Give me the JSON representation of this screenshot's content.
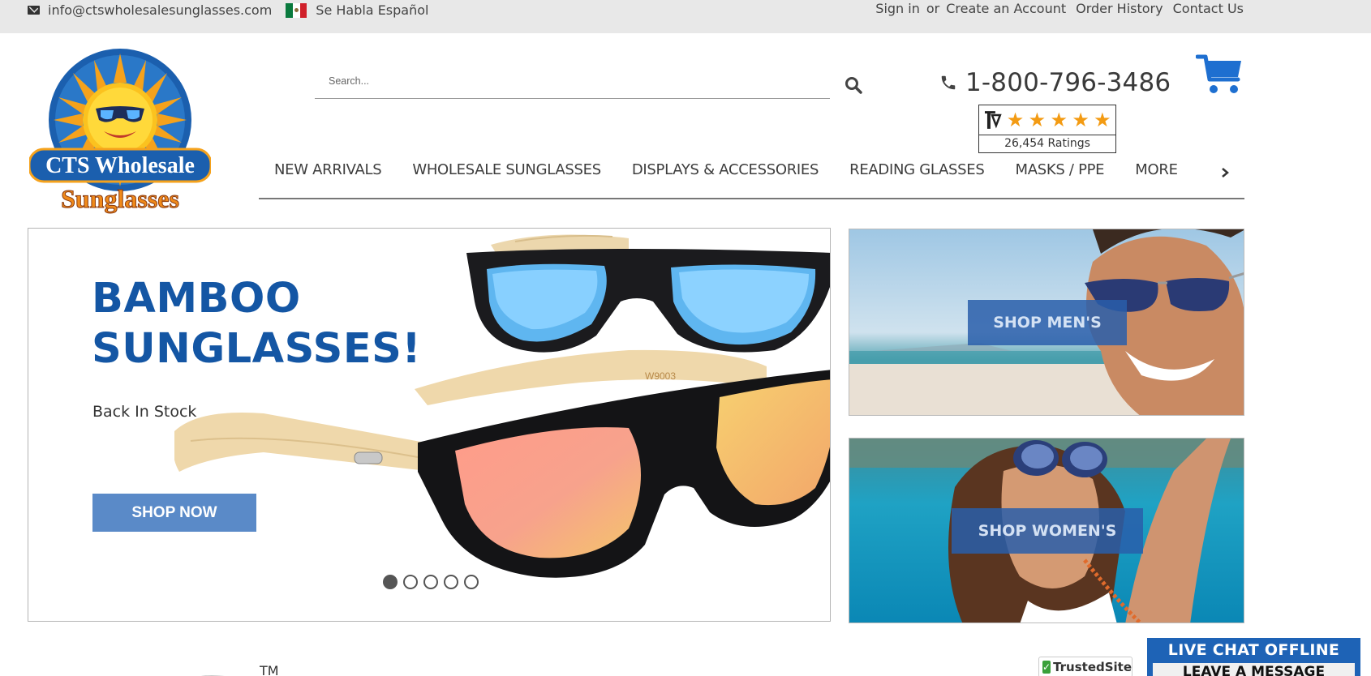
{
  "topbar": {
    "email": "info@ctswholesalesunglasses.com",
    "spanish": "Se Habla Español",
    "sign_in": "Sign in",
    "or": "or",
    "create_account": "Create an Account",
    "order_history": "Order History",
    "contact_us": "Contact Us"
  },
  "logo": {
    "line1": "CTS Wholesale",
    "line2": "Sunglasses"
  },
  "search": {
    "placeholder": "Search..."
  },
  "phone": "1-800-796-3486",
  "rating": {
    "stars": 5,
    "count_text": "26,454 Ratings"
  },
  "nav": {
    "items": [
      "NEW ARRIVALS",
      "WHOLESALE SUNGLASSES",
      "DISPLAYS & ACCESSORIES",
      "READING GLASSES",
      "MASKS / PPE",
      "MORE"
    ]
  },
  "hero": {
    "title_line1": "BAMBOO",
    "title_line2": "SUNGLASSES!",
    "subtitle": "Back In Stock",
    "cta": "SHOP NOW",
    "glasses_code": "W9003",
    "slides": 5,
    "active_slide": 1
  },
  "tiles": {
    "men": "SHOP MEN'S",
    "women": "SHOP WOMEN'S"
  },
  "footer": {
    "tm": "TM",
    "trusted": "TrustedSite",
    "livechat_title": "LIVE CHAT OFFLINE",
    "livechat_sub": "LEAVE A MESSAGE"
  },
  "colors": {
    "brand_blue": "#1456a4",
    "button_blue": "#5a8ac8",
    "star_orange": "#f39b13",
    "topbar_bg": "#e8e8e8"
  }
}
